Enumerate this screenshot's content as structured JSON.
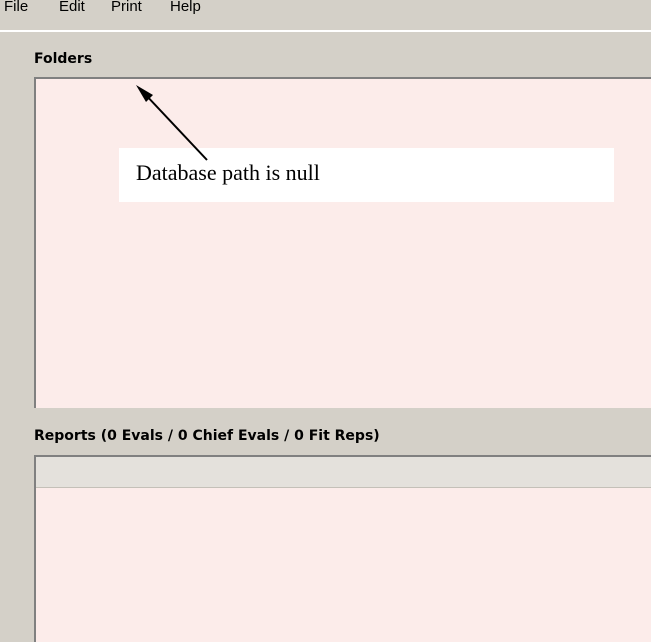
{
  "menu": {
    "file": "File",
    "edit": "Edit",
    "print": "Print",
    "help": "Help"
  },
  "folders": {
    "label": "Folders"
  },
  "reports": {
    "label": "Reports (0 Evals / 0 Chief Evals / 0 Fit Reps)"
  },
  "annotation": {
    "text": "Database path is null"
  },
  "colors": {
    "window_bg": "#d4d0c8",
    "panel_bg": "#fcecea"
  }
}
